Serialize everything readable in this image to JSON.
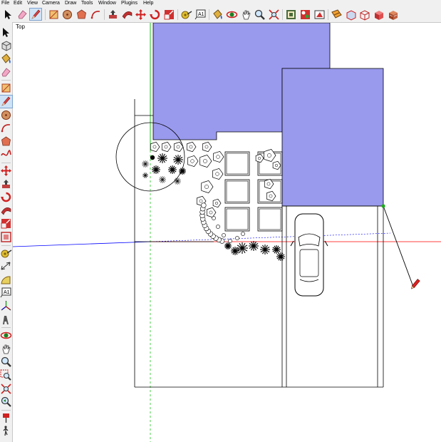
{
  "menu": [
    "File",
    "Edit",
    "View",
    "Camera",
    "Draw",
    "Tools",
    "Window",
    "Plugins",
    "Help"
  ],
  "toolbar": {
    "buttons": [
      {
        "name": "select-icon",
        "active": false
      },
      {
        "name": "eraser-icon",
        "active": false
      },
      {
        "name": "line-pencil-icon",
        "active": true
      },
      {
        "name": "rectangle-icon",
        "active": false
      },
      {
        "name": "circle-icon",
        "active": false
      },
      {
        "name": "polygon-icon",
        "active": false
      },
      {
        "name": "arc-icon",
        "active": false
      },
      {
        "name": "push-pull-icon",
        "active": false
      },
      {
        "name": "follow-me-icon",
        "active": false
      },
      {
        "name": "move-icon",
        "active": false
      },
      {
        "name": "rotate-icon",
        "active": false
      },
      {
        "name": "scale-icon",
        "active": false
      },
      {
        "name": "tape-measure-icon",
        "active": false
      },
      {
        "name": "text-label-icon",
        "active": false
      },
      {
        "name": "paint-bucket-icon",
        "active": false
      },
      {
        "name": "orbit-icon",
        "active": false
      },
      {
        "name": "pan-icon",
        "active": false
      },
      {
        "name": "zoom-icon",
        "active": false
      },
      {
        "name": "zoom-extents-icon",
        "active": false
      },
      {
        "name": "components-icon",
        "active": false
      },
      {
        "name": "materials-icon",
        "active": false
      },
      {
        "name": "styles-icon",
        "active": false
      },
      {
        "name": "section-plane-icon",
        "active": false
      },
      {
        "name": "xray-style-icon",
        "active": false
      },
      {
        "name": "wireframe-style-icon",
        "active": false
      },
      {
        "name": "shaded-style-icon",
        "active": false
      },
      {
        "name": "textured-style-icon",
        "active": false
      }
    ]
  },
  "left_toolbar": {
    "buttons": [
      {
        "name": "select-icon",
        "active": false
      },
      {
        "name": "make-component-icon",
        "active": false
      },
      {
        "name": "paint-bucket-icon",
        "active": false
      },
      {
        "name": "eraser-icon",
        "active": false
      },
      {
        "name": "rectangle-icon",
        "active": false
      },
      {
        "name": "line-pencil-icon",
        "active": true
      },
      {
        "name": "circle-icon",
        "active": false
      },
      {
        "name": "arc-icon",
        "active": false
      },
      {
        "name": "polygon-icon",
        "active": false
      },
      {
        "name": "freehand-icon",
        "active": false
      },
      {
        "name": "move-icon",
        "active": false
      },
      {
        "name": "push-pull-icon",
        "active": false
      },
      {
        "name": "rotate-icon",
        "active": false
      },
      {
        "name": "follow-me-icon",
        "active": false
      },
      {
        "name": "scale-icon",
        "active": false
      },
      {
        "name": "offset-icon",
        "active": false
      },
      {
        "name": "tape-measure-icon",
        "active": false
      },
      {
        "name": "dimension-icon",
        "active": false
      },
      {
        "name": "protractor-icon",
        "active": false
      },
      {
        "name": "text-label-icon",
        "active": false
      },
      {
        "name": "axes-icon",
        "active": false
      },
      {
        "name": "3d-text-icon",
        "active": false
      },
      {
        "name": "orbit-icon",
        "active": false
      },
      {
        "name": "pan-icon",
        "active": false
      },
      {
        "name": "zoom-icon",
        "active": false
      },
      {
        "name": "zoom-window-icon",
        "active": false
      },
      {
        "name": "zoom-extents-icon",
        "active": false
      },
      {
        "name": "previous-view-icon",
        "active": false
      },
      {
        "name": "position-camera-icon",
        "active": false
      },
      {
        "name": "walk-icon",
        "active": false
      }
    ]
  },
  "viewport": {
    "scene_label": "Top",
    "colors": {
      "building_fill": "#9999ee",
      "axis_red": "#ff0000",
      "axis_green": "#00bb00",
      "axis_blue": "#0000ff",
      "drawing_lines": "#000000",
      "endpoint": "#22aa22",
      "pencil_cursor": "#dd2222"
    }
  }
}
